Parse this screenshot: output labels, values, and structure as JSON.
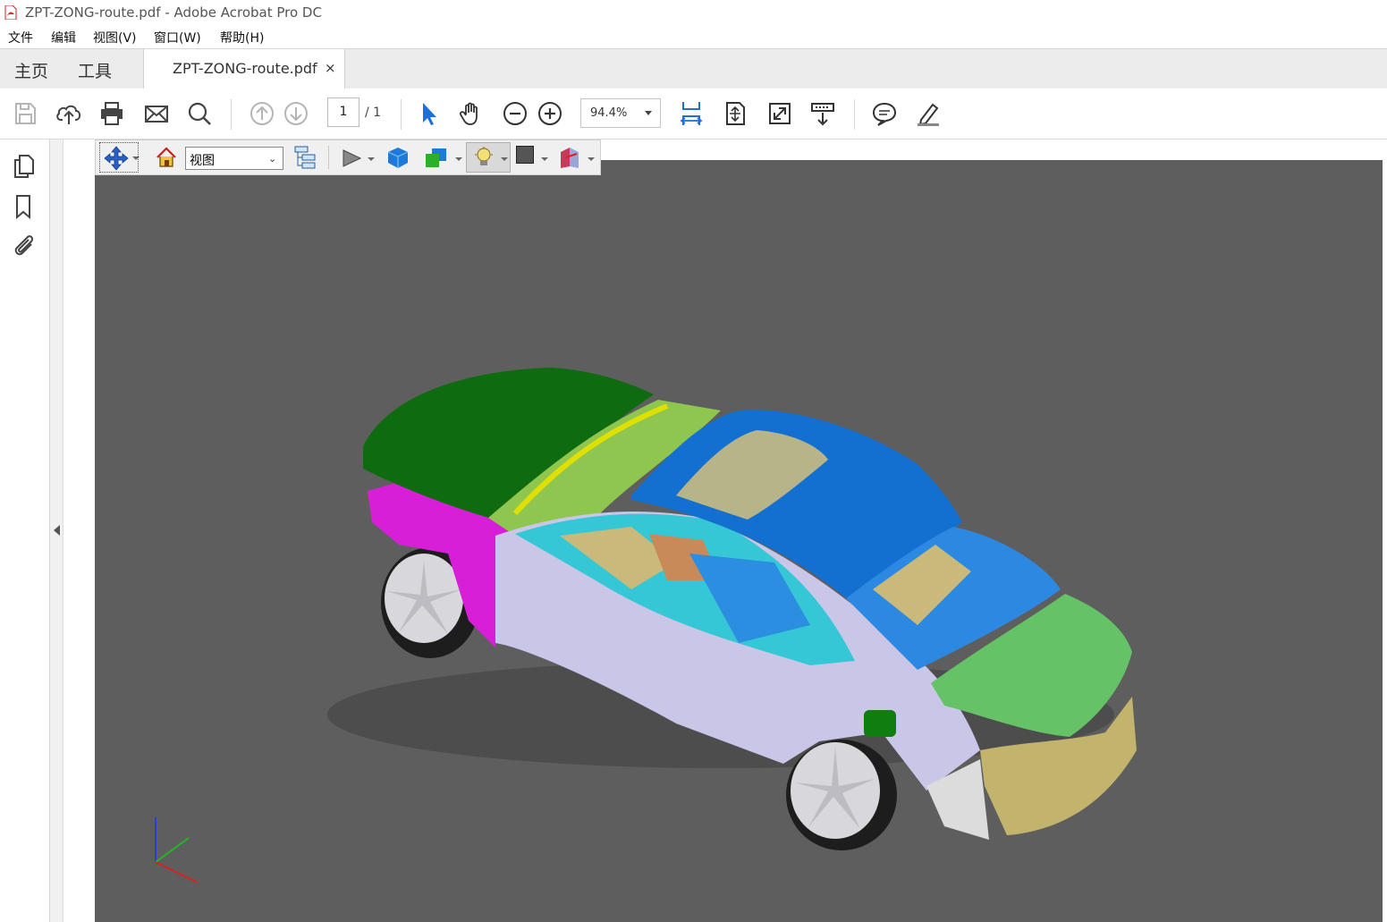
{
  "window": {
    "title": "ZPT-ZONG-route.pdf - Adobe Acrobat Pro DC"
  },
  "menu": [
    "文件",
    "编辑",
    "视图(V)",
    "窗口(W)",
    "帮助(H)"
  ],
  "nav_tabs": {
    "home": "主页",
    "tools": "工具"
  },
  "document_tab": {
    "label": "ZPT-ZONG-route.pdf",
    "close": "×"
  },
  "toolbar": {
    "page_current": "1",
    "page_total": "/ 1",
    "zoom": "94.4%",
    "icons": [
      "save-icon",
      "upload-icon",
      "print-icon",
      "email-icon",
      "search-icon",
      "page-up-icon",
      "page-down-icon",
      "select-arrow-icon",
      "hand-icon",
      "zoom-out-icon",
      "zoom-in-icon",
      "fit-width-icon",
      "fit-page-icon",
      "full-screen-icon",
      "read-mode-icon",
      "comment-icon",
      "highlight-pen-icon"
    ]
  },
  "tool_3d": {
    "view_select": "视图",
    "icons": [
      "rotate-tool-icon",
      "home-view-icon",
      "model-tree-icon",
      "play-animation-icon",
      "projection-icon",
      "render-mode-icon",
      "lighting-icon",
      "background-color-icon",
      "cross-section-icon"
    ]
  },
  "left_panel": {
    "icons": [
      "page-thumbnails-icon",
      "bookmark-icon",
      "attachment-icon"
    ]
  },
  "colors": {
    "viewport_bg": "#5e5e5e",
    "hood": "#0f6b0f",
    "roof": "#1470d0",
    "trunk": "#66c266",
    "fender": "#d81fd8",
    "body": "#c9c6e8"
  }
}
